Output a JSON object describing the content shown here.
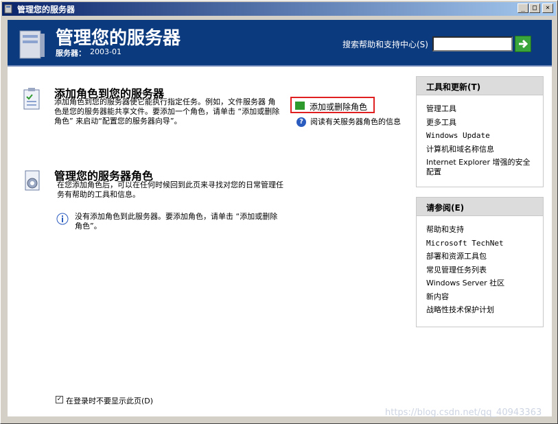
{
  "window": {
    "title": "管理您的服务器",
    "controls": [
      "_",
      "□",
      "×"
    ]
  },
  "header": {
    "title": "管理您的服务器",
    "server_label": "服务器：",
    "server_value": "2003-01",
    "search_label": "搜索帮助和支持中心(S)",
    "search_value": ""
  },
  "add_roles": {
    "title": "添加角色到您的服务器",
    "description": "添加角色到您的服务器使它能执行指定任务。例如，文件服务器 角色是您的服务器能共享文件。要添加一个角色，请单击 “添加或删除角色” 来启动“配置您的服务器向导”。",
    "add_remove_link": "添加或删除角色",
    "read_more_link": "阅读有关服务器角色的信息"
  },
  "manage_roles": {
    "title": "管理您的服务器角色",
    "description": "在您添加角色后，可以在任何时候回到此页来寻找对您的日常管理任务有帮助的工具和信息。",
    "info_note": "没有添加角色到此服务器。要添加角色，请单击 “添加或删除角色”。"
  },
  "footer": {
    "dont_show_checkbox": "在登录时不要显示此页(D)",
    "checked": true
  },
  "tools_panel": {
    "title": "工具和更新(T)",
    "items": [
      "管理工具",
      "更多工具",
      "Windows Update",
      "计算机和域名称信息",
      "Internet Explorer 增强的安全配置"
    ]
  },
  "see_also_panel": {
    "title": "请参阅(E)",
    "items": [
      "帮助和支持",
      "Microsoft TechNet",
      "部署和资源工具包",
      "常见管理任务列表",
      "Windows Server 社区",
      "新内容",
      "战略性技术保护计划"
    ]
  },
  "watermark": "https://blog.csdn.net/qq_40943363"
}
